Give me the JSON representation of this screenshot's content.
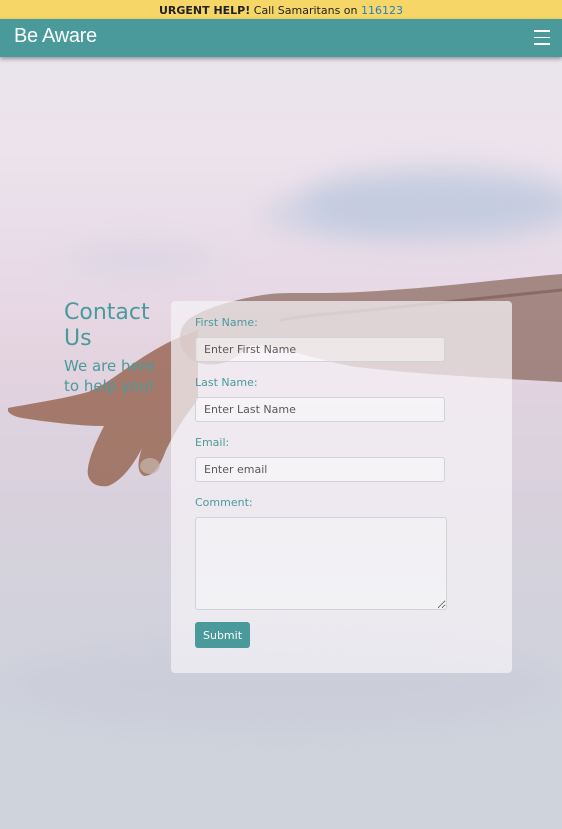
{
  "alert": {
    "urgent": "URGENT HELP!",
    "text": " Call Samaritans on ",
    "phone": "116123"
  },
  "nav": {
    "brand": "Be Aware",
    "menu_icon": "hamburger-menu-icon"
  },
  "contact": {
    "title": "Contact Us",
    "subtitle": "We are here to help you!"
  },
  "form": {
    "first_name_label": "First Name:",
    "first_name_placeholder": "Enter First Name",
    "last_name_label": "Last Name:",
    "last_name_placeholder": "Enter Last Name",
    "email_label": "Email:",
    "email_placeholder": "Enter email",
    "comment_label": "Comment:",
    "submit_label": "Submit"
  },
  "colors": {
    "accent": "#4a9a9c",
    "alert_bg": "#f5d667",
    "phone_link": "#2a7dc4"
  }
}
